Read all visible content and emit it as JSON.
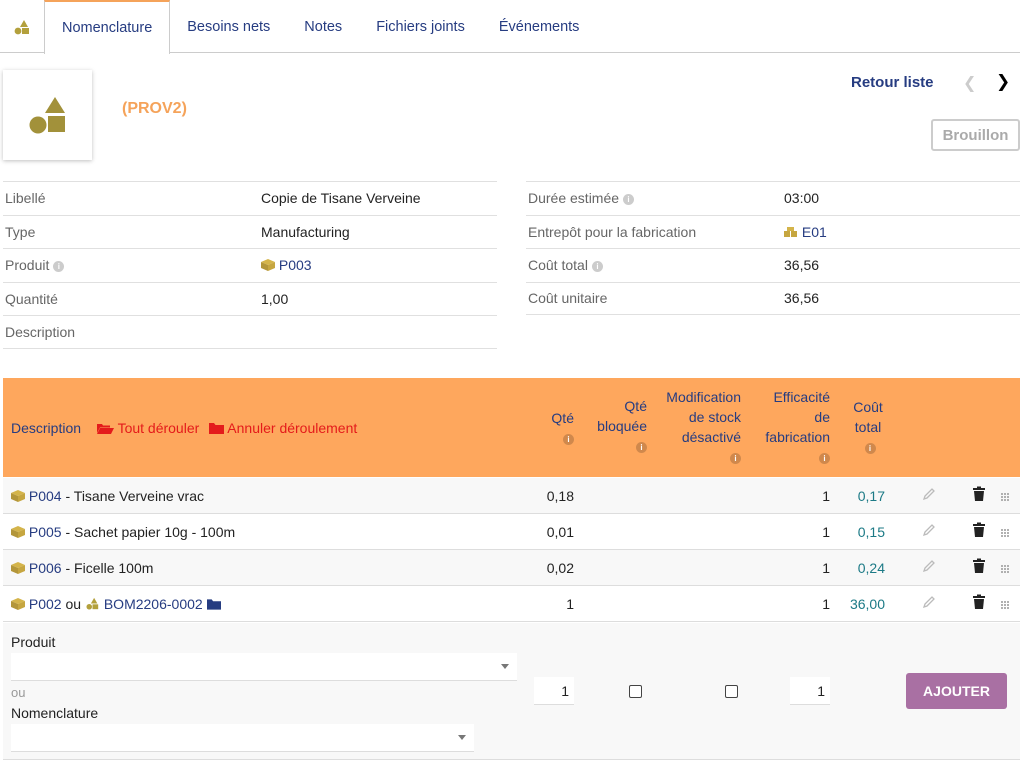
{
  "tabs": [
    "Nomenclature",
    "Besoins nets",
    "Notes",
    "Fichiers joints",
    "Événements"
  ],
  "header": {
    "ref": "(PROV2)",
    "back_label": "Retour liste",
    "prev_label": "‹",
    "next_label": "›",
    "status": "Brouillon"
  },
  "fields_left": [
    {
      "label": "Libellé",
      "value": "Copie de Tisane Verveine"
    },
    {
      "label": "Type",
      "value": "Manufacturing"
    },
    {
      "label": "Produit",
      "value": "P003"
    },
    {
      "label": "Quantité",
      "value": "1,00"
    },
    {
      "label": "Description",
      "value": ""
    }
  ],
  "fields_right": [
    {
      "label": "Durée estimée",
      "value": "03:00"
    },
    {
      "label": "Entrepôt pour la fabrication",
      "value": "E01"
    },
    {
      "label": "Coût total",
      "value": "36,56"
    },
    {
      "label": "Coût unitaire",
      "value": "36,56"
    }
  ],
  "table": {
    "col_description": "Description",
    "expand_all": "Tout dérouler",
    "collapse_all": "Annuler déroulement",
    "col_qty": "Qté",
    "col_qty_blocked_1": "Qté",
    "col_qty_blocked_2": "bloquée",
    "col_stock_1": "Modification",
    "col_stock_2": "de stock",
    "col_stock_3": "désactivé",
    "col_eff_1": "Efficacité",
    "col_eff_2": "de",
    "col_eff_3": "fabrication",
    "col_cost_1": "Coût",
    "col_cost_2": "total",
    "rows": [
      {
        "ref": "P004",
        "label": " - Tisane Verveine vrac",
        "qty": "0,18",
        "eff": "1",
        "cost": "0,17"
      },
      {
        "ref": "P005",
        "label": " - Sachet papier 10g - 100m",
        "qty": "0,01",
        "eff": "1",
        "cost": "0,15"
      },
      {
        "ref": "P006",
        "label": " - Ficelle 100m",
        "qty": "0,02",
        "eff": "1",
        "cost": "0,24"
      }
    ],
    "last_row": {
      "ref": "P002",
      "or": " ou ",
      "bom": "BOM2206-0002",
      "qty": "1",
      "eff": "1",
      "cost": "36,00"
    }
  },
  "add_form": {
    "product_label": "Produit",
    "or_label": "ou",
    "bom_label": "Nomenclature",
    "qty_value": "1",
    "eff_value": "1",
    "add_button": "AJOUTER"
  },
  "colors": {
    "accent": "#fea75d",
    "link": "#263c81",
    "button": "#a970a3",
    "ref": "#f5a35a"
  }
}
